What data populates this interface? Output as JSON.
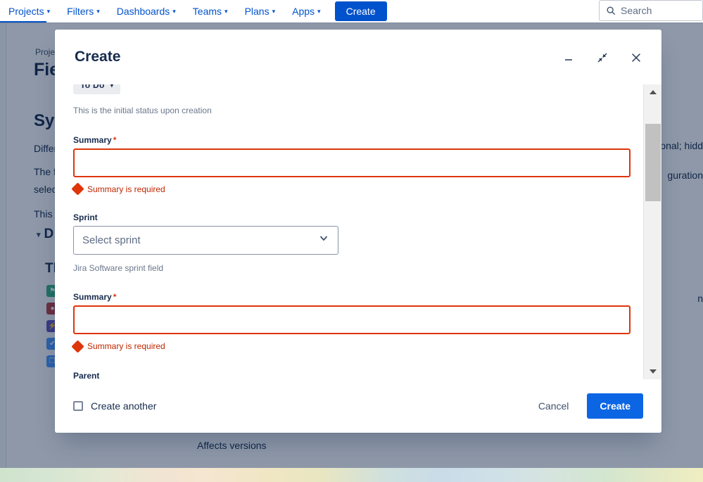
{
  "topnav": {
    "items": [
      {
        "label": "Projects",
        "has_chevron": true,
        "active": true
      },
      {
        "label": "Filters",
        "has_chevron": true,
        "active": false
      },
      {
        "label": "Dashboards",
        "has_chevron": true,
        "active": false
      },
      {
        "label": "Teams",
        "has_chevron": true,
        "active": false
      },
      {
        "label": "Plans",
        "has_chevron": true,
        "active": false
      },
      {
        "label": "Apps",
        "has_chevron": true,
        "active": false
      }
    ],
    "create_label": "Create",
    "search_placeholder": "Search",
    "search_icon": "search-icon",
    "accent_color": "#0052cc"
  },
  "background": {
    "breadcrumb": "Projec",
    "heading_1": "Fie",
    "heading_2": "Sys",
    "para_1": "Differ",
    "para_2": "The f",
    "para_3": "selec",
    "para_4": "This p",
    "accordion_label": "D",
    "heading_3": "Th",
    "right_text_1": "onal; hidd",
    "right_text_2": "guration",
    "right_text_3": "n",
    "affects_versions": "Affects versions",
    "issue_type_icons": [
      {
        "name": "story-icon",
        "glyph": "⚑",
        "color": "#36b37e"
      },
      {
        "name": "bug-icon",
        "glyph": "●",
        "color": "#bf4040"
      },
      {
        "name": "epic-icon",
        "glyph": "⚡",
        "color": "#6554c0"
      },
      {
        "name": "task-icon",
        "glyph": "✔",
        "color": "#4c9aff"
      },
      {
        "name": "subtask-icon",
        "glyph": "❐",
        "color": "#4c9aff"
      }
    ]
  },
  "modal": {
    "title": "Create",
    "window_controls": [
      {
        "name": "minimize-button",
        "icon": "minimize-icon"
      },
      {
        "name": "collapse-button",
        "icon": "collapse-arrows-icon"
      },
      {
        "name": "close-button",
        "icon": "close-icon"
      }
    ],
    "status": {
      "value": "To Do",
      "helper": "This is the initial status upon creation"
    },
    "fields": [
      {
        "label": "Summary",
        "required": true,
        "required_marker": "*",
        "type": "text",
        "value": "",
        "error": "Summary is required"
      },
      {
        "label": "Sprint",
        "required": false,
        "type": "select",
        "placeholder": "Select sprint",
        "helper": "Jira Software sprint field"
      },
      {
        "label": "Summary",
        "required": true,
        "required_marker": "*",
        "type": "text",
        "value": "",
        "error": "Summary is required"
      }
    ],
    "next_field_label": "Parent",
    "footer": {
      "create_another_label": "Create another",
      "create_another_checked": false,
      "cancel_label": "Cancel",
      "create_label": "Create",
      "create_color": "#0c66e4"
    },
    "error_color": "#de350b"
  }
}
